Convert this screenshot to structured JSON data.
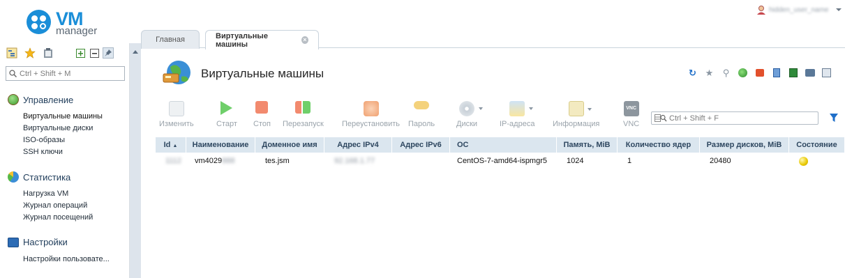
{
  "app": {
    "logo_main": "VM",
    "logo_sub": "manager",
    "user_name": "hidden_user_name"
  },
  "tabs": [
    {
      "label": "Главная"
    },
    {
      "label": "Виртуальные машины"
    }
  ],
  "sidebar": {
    "search_placeholder": "Ctrl + Shift + M",
    "groups": [
      {
        "label": "Управление",
        "items": [
          "Виртуальные машины",
          "Виртуальные диски",
          "ISO-образы",
          "SSH ключи"
        ]
      },
      {
        "label": "Статистика",
        "items": [
          "Нагрузка VM",
          "Журнал операций",
          "Журнал посещений"
        ]
      },
      {
        "label": "Настройки",
        "items": [
          "Настройки пользовате..."
        ]
      }
    ]
  },
  "page": {
    "title": "Виртуальные машины"
  },
  "toolbar": {
    "buttons": [
      "Изменить",
      "Старт",
      "Стоп",
      "Перезапуск",
      "Переустановить",
      "Пароль",
      "Диски",
      "IP-адреса",
      "Информация",
      "VNC"
    ],
    "search_placeholder": "Ctrl + Shift + F"
  },
  "table": {
    "headers": [
      "Id",
      "Наименование",
      "Доменное имя",
      "Адрес IPv4",
      "Адрес IPv6",
      "ОС",
      "Память, MiB",
      "Количество ядер",
      "Размер дисков, MiB",
      "Состояние"
    ],
    "rows": [
      {
        "id": "1112",
        "name": "vm4029",
        "name_hidden": "888",
        "domain": "tes.jsm",
        "ipv4": "92.168.1.77",
        "ipv6": "",
        "os": "CentOS-7-amd64-ispmgr5",
        "memory": "1024",
        "cores": "1",
        "disk": "20480"
      }
    ]
  },
  "colors": {
    "accent": "#1a8ed8",
    "header_bg": "#dbe6ef",
    "splitter": "#dde4ec"
  }
}
